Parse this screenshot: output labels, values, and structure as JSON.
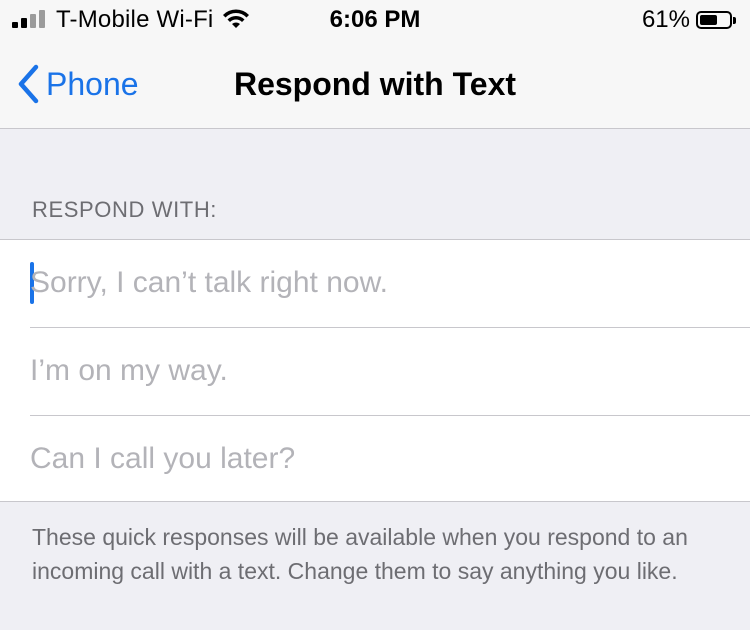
{
  "status": {
    "carrier": "T-Mobile Wi-Fi",
    "time": "6:06 PM",
    "battery_percent_label": "61%",
    "battery_level": 0.61,
    "signal_bars_filled": 2,
    "signal_bars_total": 4,
    "wifi_icon": "wifi-icon",
    "battery_icon": "battery-icon"
  },
  "nav": {
    "back_label": "Phone",
    "title": "Respond with Text",
    "back_icon": "chevron-left-icon"
  },
  "section": {
    "header": "RESPOND WITH:"
  },
  "responses": [
    {
      "placeholder": "Sorry, I can’t talk right now."
    },
    {
      "placeholder": "I’m on my way."
    },
    {
      "placeholder": "Can I call you later?"
    }
  ],
  "footer": {
    "text": "These quick responses will be available when you respond to an incoming call with a text. Change them to say anything you like."
  },
  "colors": {
    "accent": "#1a73e8",
    "background": "#efeff4",
    "secondary_text": "#6d6d72",
    "placeholder_text": "#b3b3b8",
    "separator": "#c8c7cc"
  }
}
